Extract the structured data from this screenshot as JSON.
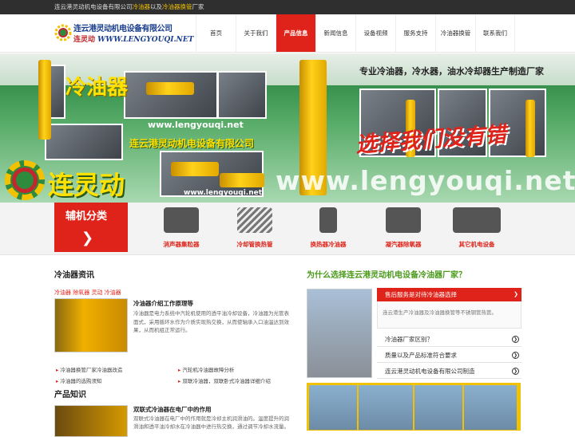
{
  "topbar": {
    "text_a": "连云港灵动机电设备有限公司",
    "text_b": "冷油器",
    "text_c": "以及",
    "text_d": "冷油器换管",
    "text_e": "厂家"
  },
  "logo": {
    "line1": "连云港灵动机电设备有限公司",
    "line2_cn": "连灵动",
    "line2_url": "WWW.LENGYOUQI.NET"
  },
  "nav": {
    "items": [
      "首页",
      "关于我们",
      "产品信息",
      "新闻信息",
      "设备视频",
      "服务支持",
      "冷油器换管",
      "联系我们"
    ],
    "active_index": 2
  },
  "banner": {
    "slogan": "专业冷油器，冷水器，油水冷却器生产制造厂家",
    "heading": "冷油器",
    "url1": "www.lengyouqi.net",
    "company": "连云港灵动机电设备有限公司",
    "brand": "连灵动",
    "url2": "www.lengyouqi.net",
    "big_url": "www.lengyouqi.net",
    "choose": "选择我们没有错"
  },
  "categories": {
    "title": "辅机分类",
    "arrow": "❯",
    "items": [
      "消声器集粒器",
      "冷却管换热管",
      "换热器冷油器",
      "凝汽器除氧器",
      "其它机电设备"
    ]
  },
  "news": {
    "title": "冷油器资讯",
    "tags": "冷油器  除氧器  灵动  冷油器",
    "headline": "冷油器介绍工作原理等",
    "summary": "冷油器是电力系统中汽轮机使用的透平油冷却设备，冷油器为光管表面式，采用循环水作为介质实现热交换，从而使轴承入口油温达到效果，从而机组正常运行。",
    "links": [
      "冷油器换管厂家冷油器改造",
      "汽轮机冷油器故障分析",
      "冷油器的选购须知",
      "双联冷油器，双联卧式冷油器详细介绍"
    ]
  },
  "product": {
    "title": "产品知识",
    "headline": "双联式冷油器在电厂中的作用",
    "summary": "双联式冷油器在电厂中的作用就是冷却主机润滑油的。温度提升的润滑油和透平油冷却水在冷油器中进行热交换，通过调节冷却水流量。"
  },
  "why": {
    "title": "为什么选择连云港灵动机电设备冷油器厂家？",
    "open_q": "售后服务是对待冷油器选择",
    "open_a": "连云港生产冷油器及冷油器换管等不锈钢管热管。",
    "items": [
      "冷油器厂家区别？",
      "质量以及产品标准符合要求",
      "连云港灵动机电设备有限公司制造"
    ],
    "arrow": "❯"
  }
}
